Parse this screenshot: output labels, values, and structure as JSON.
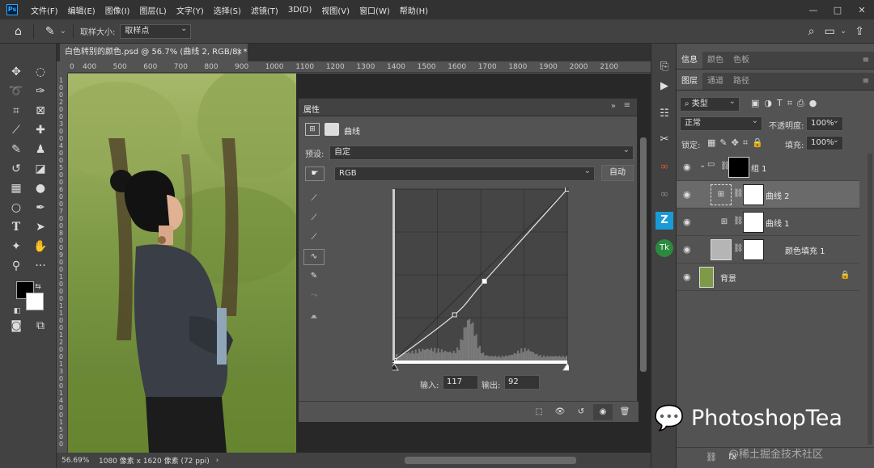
{
  "menu": {
    "app_icon": "Ps",
    "items": [
      "文件(F)",
      "编辑(E)",
      "图像(I)",
      "图层(L)",
      "文字(Y)",
      "选择(S)",
      "滤镜(T)",
      "3D(D)",
      "视图(V)",
      "窗口(W)",
      "帮助(H)"
    ],
    "window_controls": [
      "—",
      "□",
      "✕"
    ]
  },
  "options": {
    "sample_size_label": "取样大小:",
    "sample_size_value": "取样点"
  },
  "document": {
    "tab_title": "白色转别的颜色.psd @ 56.7% (曲线 2, RGB/8) *",
    "tab_close": "×",
    "ruler_h": [
      "0",
      "400",
      "500",
      "600",
      "700",
      "800",
      "900",
      "1000",
      "1100",
      "1200",
      "1300",
      "1400",
      "1500",
      "1600",
      "1700",
      "1800",
      "1900",
      "2000",
      "2100"
    ],
    "ruler_v": [
      "1",
      "0",
      "0",
      "2",
      "0",
      "0",
      "3",
      "0",
      "0",
      "4",
      "0",
      "0",
      "5",
      "0",
      "0",
      "6",
      "0",
      "0",
      "7",
      "0",
      "0",
      "8",
      "0",
      "0",
      "9",
      "0",
      "0",
      "1",
      "0",
      "0",
      "0",
      "1",
      "1",
      "0",
      "0",
      "1",
      "2",
      "0",
      "0",
      "1",
      "3",
      "0",
      "0",
      "1",
      "4",
      "0",
      "0",
      "1",
      "5",
      "0",
      "0"
    ]
  },
  "status": {
    "zoom": "56.69%",
    "doc_size": "1080 像素 x 1620 像素 (72 ppi)",
    "arrow": "›"
  },
  "properties": {
    "panel_title": "属性",
    "collapse": "»",
    "adjustment_name": "曲线",
    "preset_label": "预设:",
    "preset_value": "自定",
    "channel_value": "RGB",
    "auto_button": "自动",
    "input_label": "输入:",
    "input_value": "117",
    "output_label": "输出:",
    "output_value": "92"
  },
  "curve": {
    "points": [
      [
        0,
        0
      ],
      [
        89,
        68
      ],
      [
        133,
        118
      ],
      [
        255,
        255
      ]
    ],
    "range": [
      0,
      255
    ]
  },
  "right_panel": {
    "top_tabs": [
      "信息",
      "颜色",
      "色板"
    ],
    "layer_tabs": [
      "图层",
      "通道",
      "路径"
    ],
    "filter_label": "类型",
    "blend_mode": "正常",
    "opacity_label": "不透明度:",
    "opacity_value": "100%",
    "lock_label": "锁定:",
    "fill_label": "填充:",
    "fill_value": "100%",
    "layers": [
      {
        "name": "组 1"
      },
      {
        "name": "曲线 2"
      },
      {
        "name": "曲线 1"
      },
      {
        "name": "颜色填充 1"
      },
      {
        "name": "背景"
      }
    ]
  },
  "watermark": {
    "text": "PhotoshopTea",
    "sub": "@稀土掘金技术社区"
  },
  "colors": {
    "bg_dark": "#323232",
    "panel": "#424242",
    "workspace": "#535353",
    "selection": "#6a6a6a"
  }
}
